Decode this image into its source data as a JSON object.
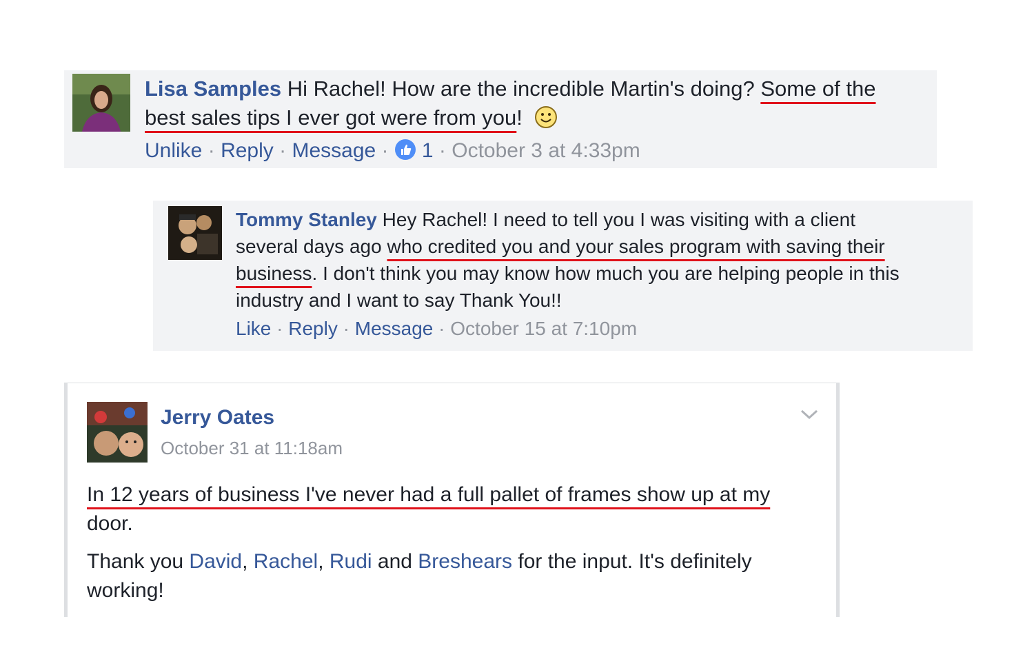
{
  "comments": [
    {
      "author": "Lisa Samples",
      "text_plain_1": "Hi Rachel! How are the incredible Martin's doing? ",
      "text_highlight_1": "Some of the",
      "text_highlight_2": "best sales tips I ever got were from you",
      "text_plain_2": "!",
      "actions": {
        "unlike": "Unlike",
        "reply": "Reply",
        "message": "Message",
        "like_count": "1",
        "timestamp": "October 3 at 4:33pm"
      },
      "separator": "·"
    },
    {
      "author": "Tommy Stanley",
      "line1": "Hey Rachel! I need to tell you I was visiting with a client",
      "line2_plain": "several days ago ",
      "line2_highlight": "who credited you and your sales program with saving their",
      "line3_highlight": "business",
      "line3_plain": ". I don't think you may know how much you are helping people in this",
      "line4": "industry and I want to say Thank You!!",
      "actions": {
        "like": "Like",
        "reply": "Reply",
        "message": "Message",
        "timestamp": "October 15 at 7:10pm"
      },
      "separator": "·"
    }
  ],
  "post": {
    "author": "Jerry Oates",
    "timestamp": "October 31 at 11:18am",
    "highlight_line": "In 12 years of business I've never had a full pallet of frames show up at my",
    "line2": "door.",
    "thanks_prefix": "Thank you ",
    "mention_1": "David",
    "comma_1": ", ",
    "mention_2": "Rachel",
    "comma_2": ", ",
    "mention_3": "Rudi",
    "and_text": " and ",
    "mention_4": "Breshears",
    "thanks_suffix": " for the input. It's definitely",
    "line4": "working!"
  },
  "colors": {
    "link": "#365899",
    "muted": "#90949c",
    "underline": "#e0121b",
    "box_bg": "#f2f3f5"
  },
  "icons": {
    "smiley": "smiley-icon",
    "like_badge": "thumbs-up-icon",
    "chevron": "chevron-down-icon"
  }
}
